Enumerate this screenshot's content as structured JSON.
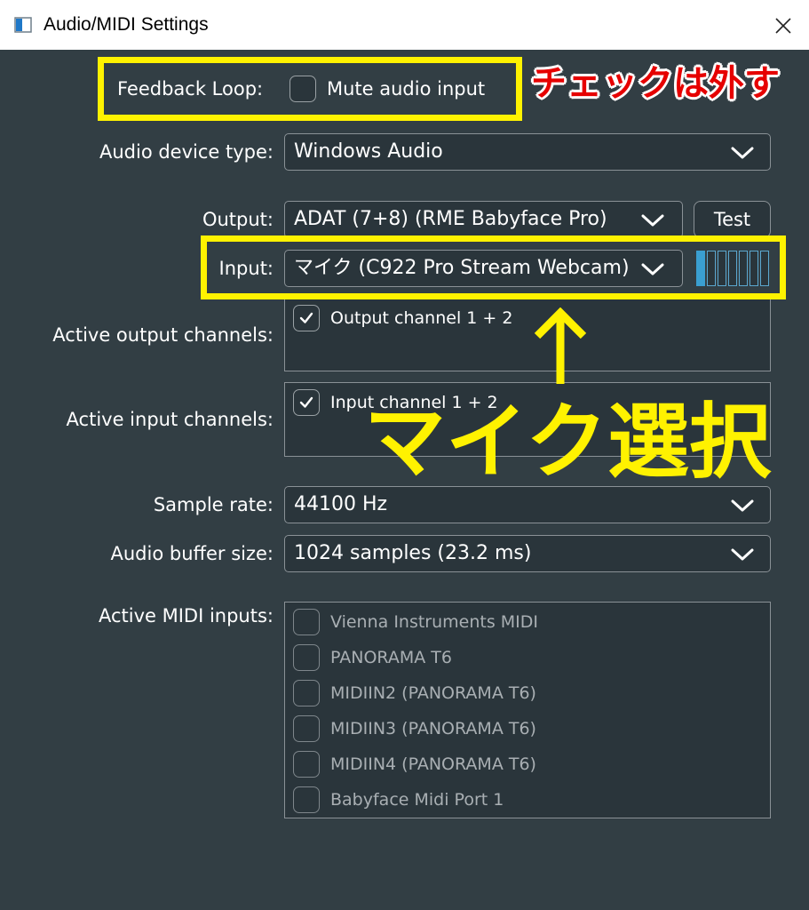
{
  "window": {
    "title": "Audio/MIDI Settings"
  },
  "feedback": {
    "label": "Feedback Loop:",
    "mute_label": "Mute audio input",
    "mute_checked": false
  },
  "device_type": {
    "label": "Audio device type:",
    "value": "Windows Audio"
  },
  "output": {
    "label": "Output:",
    "value": "ADAT (7+8) (RME Babyface Pro)",
    "test_label": "Test"
  },
  "input": {
    "label": "Input:",
    "value": "マイク (C922 Pro Stream Webcam)",
    "level": 0.2
  },
  "active_output": {
    "label": "Active output channels:",
    "channels": [
      {
        "label": "Output channel 1 + 2",
        "checked": true
      }
    ]
  },
  "active_input": {
    "label": "Active input channels:",
    "channels": [
      {
        "label": "Input channel 1 + 2",
        "checked": true
      }
    ]
  },
  "sample_rate": {
    "label": "Sample rate:",
    "value": "44100 Hz"
  },
  "buffer_size": {
    "label": "Audio buffer size:",
    "value": "1024 samples (23.2 ms)"
  },
  "midi": {
    "label": "Active MIDI inputs:",
    "inputs": [
      {
        "label": "Vienna Instruments MIDI",
        "checked": false
      },
      {
        "label": "PANORAMA T6",
        "checked": false
      },
      {
        "label": "MIDIIN2 (PANORAMA T6)",
        "checked": false
      },
      {
        "label": "MIDIIN3 (PANORAMA T6)",
        "checked": false
      },
      {
        "label": "MIDIIN4 (PANORAMA T6)",
        "checked": false
      },
      {
        "label": "Babyface Midi Port 1",
        "checked": false
      }
    ]
  },
  "annotations": {
    "uncheck_note": "チェックは外す",
    "select_mic_note": "マイク選択",
    "highlight_color": "#fff200",
    "note_color": "#e60000"
  },
  "icons": {
    "app": "app-window-icon",
    "close": "close-icon",
    "dropdown": "chevron-down-icon",
    "check": "check-icon",
    "arrow": "arrow-up-icon"
  }
}
